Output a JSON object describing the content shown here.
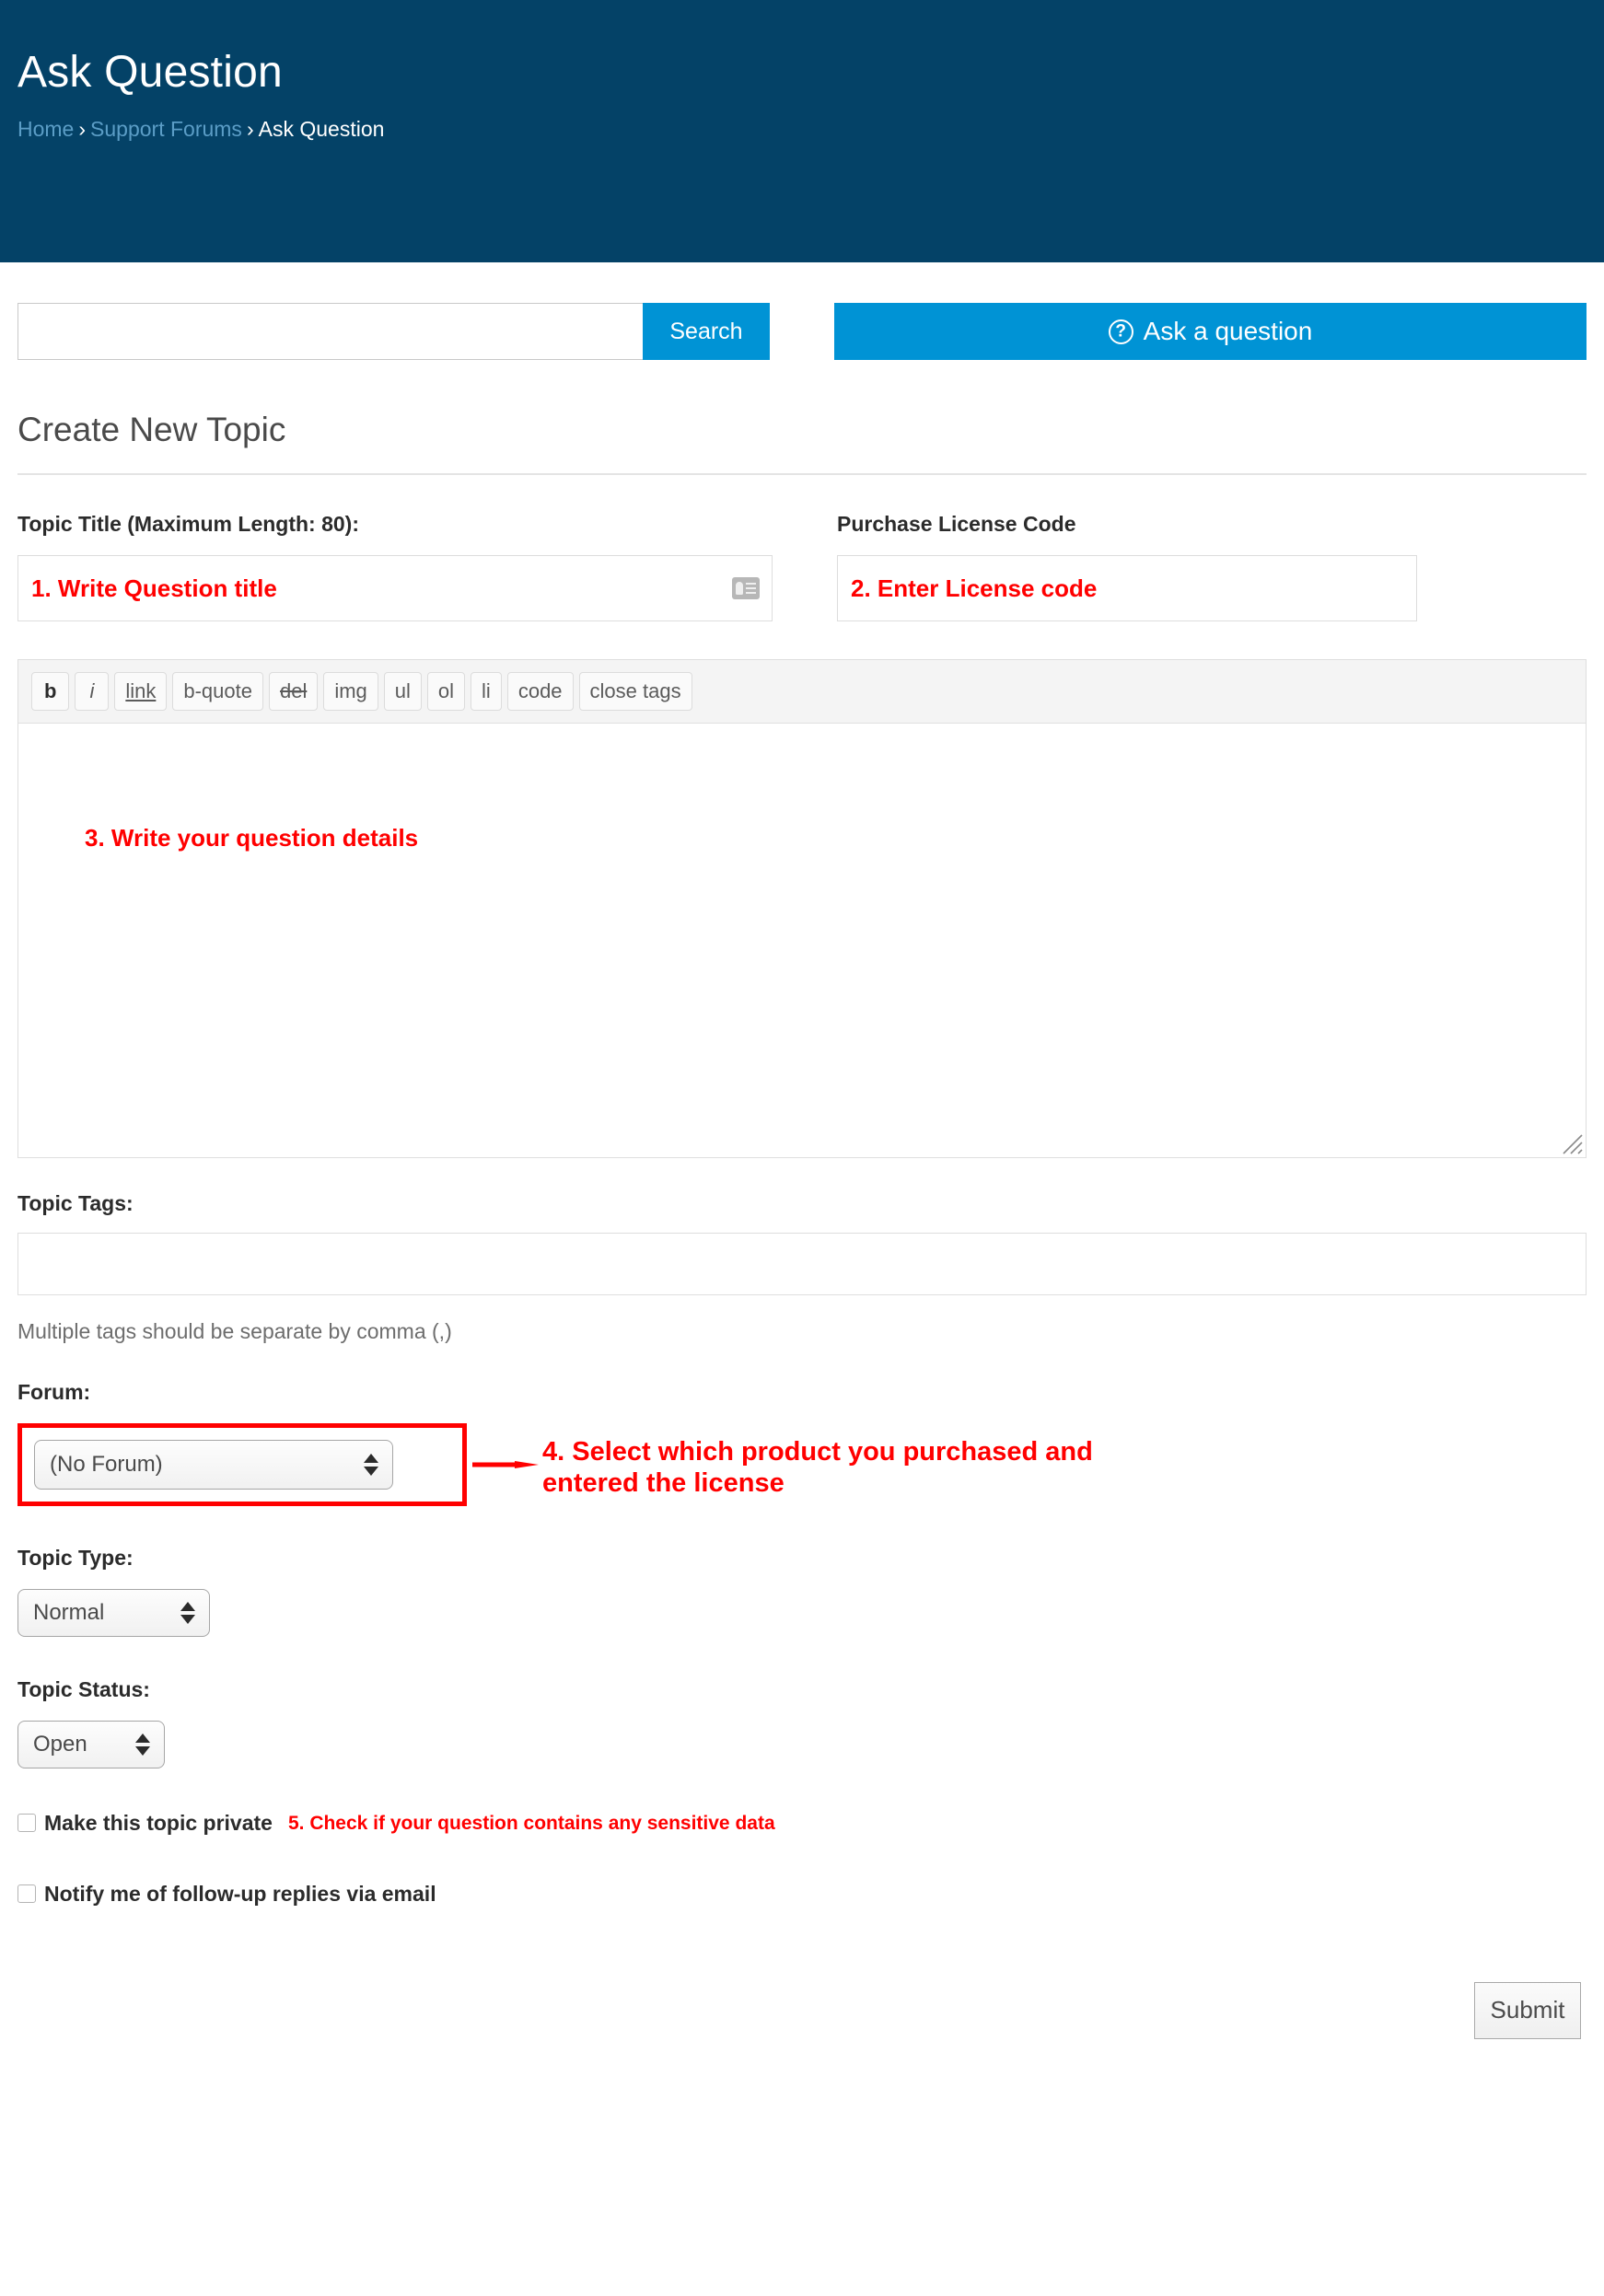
{
  "header": {
    "title": "Ask Question",
    "breadcrumb": {
      "home": "Home",
      "sep1": "›",
      "forums": "Support Forums",
      "sep2": "›",
      "current": "Ask Question"
    },
    "bg_color": "#044267",
    "link_color": "#5b9dc6"
  },
  "search": {
    "value": "",
    "placeholder": "",
    "submit_label": "Search",
    "button_color": "#0093d5"
  },
  "ask_button": {
    "label": "Ask a question",
    "icon": "question-circle-icon",
    "color": "#0093d5"
  },
  "form": {
    "section_title": "Create New Topic",
    "topic_title": {
      "label": "Topic Title (Maximum Length: 80):",
      "value": "1. Write Question title",
      "placeholder": "",
      "icon": "autofill-contact-card-icon"
    },
    "license": {
      "label": "Purchase License Code",
      "value": "2. Enter License code",
      "placeholder": ""
    },
    "editor": {
      "toolbar": [
        {
          "name": "bold",
          "label": "b"
        },
        {
          "name": "italic",
          "label": "i"
        },
        {
          "name": "link",
          "label": "link"
        },
        {
          "name": "b-quote",
          "label": "b-quote"
        },
        {
          "name": "del",
          "label": "del"
        },
        {
          "name": "img",
          "label": "img"
        },
        {
          "name": "ul",
          "label": "ul"
        },
        {
          "name": "ol",
          "label": "ol"
        },
        {
          "name": "li",
          "label": "li"
        },
        {
          "name": "code",
          "label": "code"
        },
        {
          "name": "close-tags",
          "label": "close tags"
        }
      ],
      "body_value": "3. Write your question details",
      "body_placeholder": ""
    },
    "tags": {
      "label": "Topic Tags:",
      "value": "",
      "placeholder": "",
      "help": "Multiple tags should be separate by comma (,)"
    },
    "forum": {
      "label": "Forum:",
      "selected": "(No Forum)",
      "options": [
        "(No Forum)"
      ],
      "annotation": "4. Select which product you purchased and\nentered the license",
      "highlight_color": "#ff0000"
    },
    "topic_type": {
      "label": "Topic Type:",
      "selected": "Normal",
      "options": [
        "Normal"
      ]
    },
    "topic_status": {
      "label": "Topic Status:",
      "selected": "Open",
      "options": [
        "Open"
      ]
    },
    "private": {
      "label": "Make this topic private",
      "checked": false,
      "annotation": "5. Check if your question contains any sensitive data"
    },
    "notify": {
      "label": "Notify me of follow-up replies via email",
      "checked": false
    },
    "submit_label": "Submit"
  },
  "annotation_color": "#ff0000"
}
